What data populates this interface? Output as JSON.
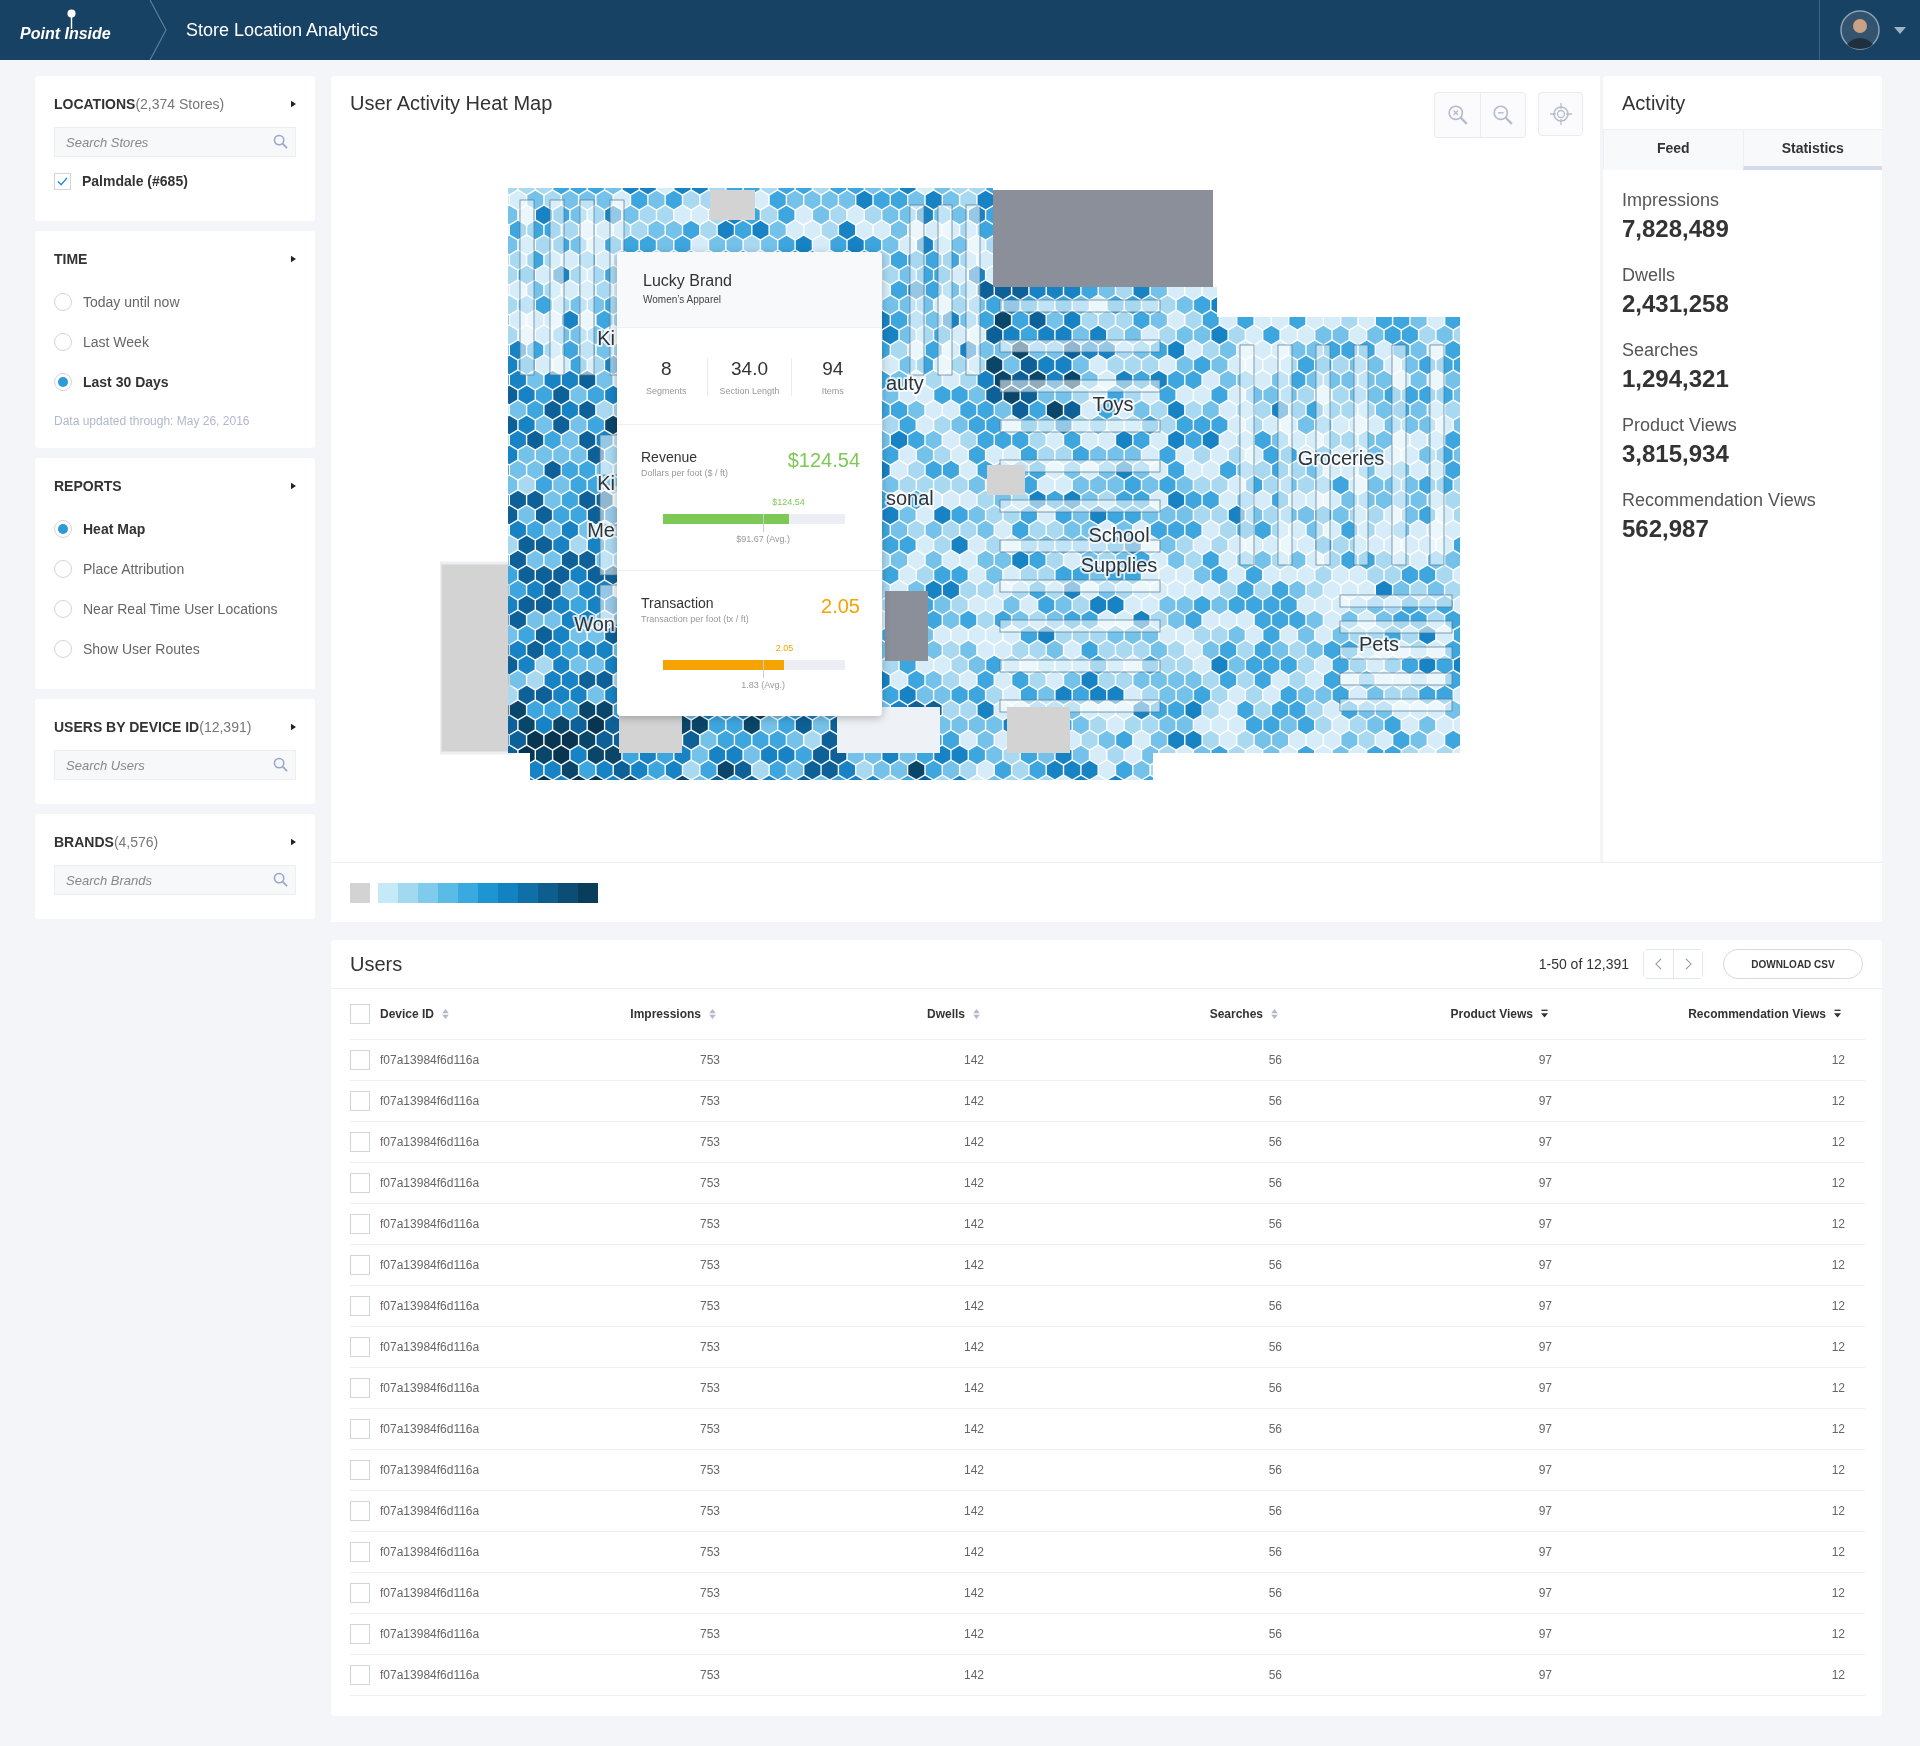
{
  "header": {
    "logo": "Point Inside",
    "title": "Store Location Analytics"
  },
  "sidebar": {
    "sections": [
      {
        "title": "LOCATIONS",
        "count": "(2,374 Stores)",
        "placeholder": "Search Stores",
        "checks": [
          {
            "label": "Palmdale (#685)",
            "checked": true
          }
        ]
      },
      {
        "title": "TIME",
        "options": [
          {
            "label": "Today until now",
            "selected": false
          },
          {
            "label": "Last Week",
            "selected": false
          },
          {
            "label": "Last 30 Days",
            "selected": true
          }
        ],
        "note": "Data updated through: May 26, 2016"
      },
      {
        "title": "REPORTS",
        "options": [
          {
            "label": "Heat Map",
            "selected": true
          },
          {
            "label": "Place Attribution",
            "selected": false
          },
          {
            "label": "Near Real Time User Locations",
            "selected": false
          },
          {
            "label": "Show User Routes",
            "selected": false
          }
        ]
      },
      {
        "title": "USERS BY DEVICE ID",
        "count": "(12,391)",
        "placeholder": "Search Users"
      },
      {
        "title": "BRANDS",
        "count": "(4,576)",
        "placeholder": "Search Brands"
      }
    ]
  },
  "heat_map": {
    "title": "User Activity Heat Map",
    "labels": [
      "Ki",
      "Ki",
      "Me",
      "Won",
      "auty",
      "sonal",
      "Toys",
      "Groceries",
      "School",
      "Supplies",
      "Pets"
    ]
  },
  "tooltip": {
    "title": "Lucky Brand",
    "subtitle": "Women’s Apparel",
    "stats": [
      {
        "value": "8",
        "label": "Segments"
      },
      {
        "value": "34.0",
        "label": "Section Length"
      },
      {
        "value": "94",
        "label": "Items"
      }
    ],
    "metrics": [
      {
        "title": "Revenue",
        "subtitle": "Dollars per foot ($ / ft)",
        "value": "$124.54",
        "color": "#7ec855",
        "level": 0.69,
        "marker": "$124.54",
        "average": "$91.67 (Avg.)"
      },
      {
        "title": "Transaction",
        "subtitle": "Transaction per foot (tx / ft)",
        "value": "2.05",
        "color": "#f5a300",
        "level": 0.667,
        "marker": "2.05",
        "average": "1.83 (Avg.)"
      }
    ]
  },
  "activity": {
    "title": "Activity",
    "tabs": [
      {
        "label": "Feed",
        "selected": false
      },
      {
        "label": "Statistics",
        "selected": true
      }
    ],
    "stats": [
      {
        "label": "Impressions",
        "value": "7,828,489"
      },
      {
        "label": "Dwells",
        "value": "2,431,258"
      },
      {
        "label": "Searches",
        "value": "1,294,321"
      },
      {
        "label": "Product Views",
        "value": "3,815,934"
      },
      {
        "label": "Recommendation Views",
        "value": "562,987"
      }
    ]
  },
  "users": {
    "title": "Users",
    "pagination": "1-50 of 12,391",
    "download": "DOWNLOAD CSV",
    "all_checked": false,
    "columns": [
      {
        "label": "Device ID",
        "sorted": false
      },
      {
        "label": "Impressions",
        "sorted": false
      },
      {
        "label": "Dwells",
        "sorted": false
      },
      {
        "label": "Searches",
        "sorted": false
      },
      {
        "label": "Product Views",
        "sorted": true
      },
      {
        "label": "Recommendation Views",
        "sorted": true
      }
    ],
    "rows": [
      {
        "checked": false,
        "cells": [
          "f07a13984f6d116a",
          "753",
          "142",
          "56",
          "97",
          "12"
        ]
      },
      {
        "checked": false,
        "cells": [
          "f07a13984f6d116a",
          "753",
          "142",
          "56",
          "97",
          "12"
        ]
      },
      {
        "checked": false,
        "cells": [
          "f07a13984f6d116a",
          "753",
          "142",
          "56",
          "97",
          "12"
        ]
      },
      {
        "checked": false,
        "cells": [
          "f07a13984f6d116a",
          "753",
          "142",
          "56",
          "97",
          "12"
        ]
      },
      {
        "checked": false,
        "cells": [
          "f07a13984f6d116a",
          "753",
          "142",
          "56",
          "97",
          "12"
        ]
      },
      {
        "checked": false,
        "cells": [
          "f07a13984f6d116a",
          "753",
          "142",
          "56",
          "97",
          "12"
        ]
      },
      {
        "checked": false,
        "cells": [
          "f07a13984f6d116a",
          "753",
          "142",
          "56",
          "97",
          "12"
        ]
      },
      {
        "checked": false,
        "cells": [
          "f07a13984f6d116a",
          "753",
          "142",
          "56",
          "97",
          "12"
        ]
      },
      {
        "checked": false,
        "cells": [
          "f07a13984f6d116a",
          "753",
          "142",
          "56",
          "97",
          "12"
        ]
      },
      {
        "checked": false,
        "cells": [
          "f07a13984f6d116a",
          "753",
          "142",
          "56",
          "97",
          "12"
        ]
      },
      {
        "checked": false,
        "cells": [
          "f07a13984f6d116a",
          "753",
          "142",
          "56",
          "97",
          "12"
        ]
      },
      {
        "checked": false,
        "cells": [
          "f07a13984f6d116a",
          "753",
          "142",
          "56",
          "97",
          "12"
        ]
      },
      {
        "checked": false,
        "cells": [
          "f07a13984f6d116a",
          "753",
          "142",
          "56",
          "97",
          "12"
        ]
      },
      {
        "checked": false,
        "cells": [
          "f07a13984f6d116a",
          "753",
          "142",
          "56",
          "97",
          "12"
        ]
      },
      {
        "checked": false,
        "cells": [
          "f07a13984f6d116a",
          "753",
          "142",
          "56",
          "97",
          "12"
        ]
      },
      {
        "checked": false,
        "cells": [
          "f07a13984f6d116a",
          "753",
          "142",
          "56",
          "97",
          "12"
        ]
      }
    ]
  }
}
